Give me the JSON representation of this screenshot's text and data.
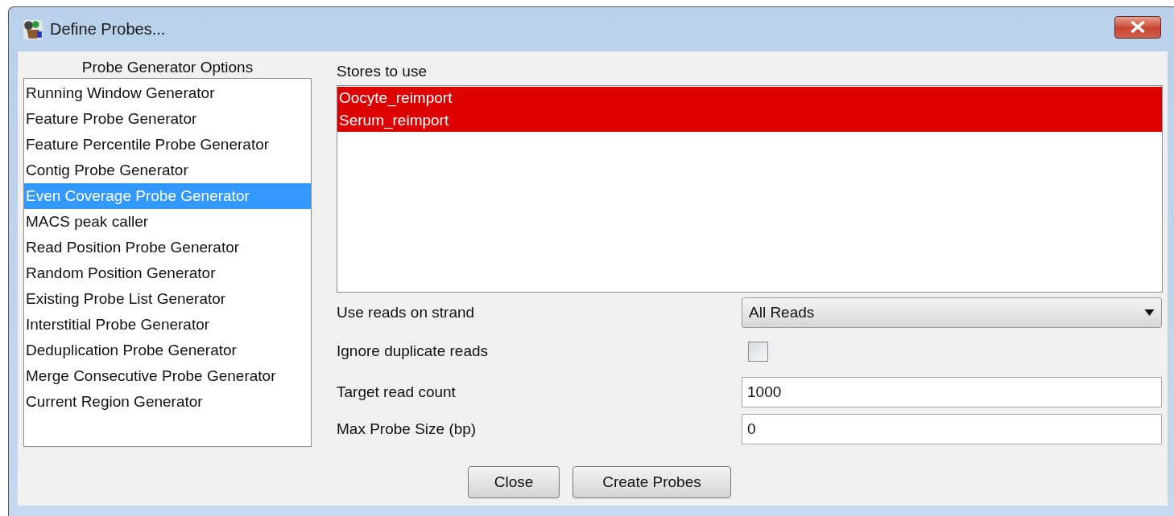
{
  "window": {
    "title": "Define Probes..."
  },
  "generator_options": {
    "heading": "Probe Generator Options",
    "items": [
      {
        "label": "Running Window Generator",
        "selected": false
      },
      {
        "label": "Feature Probe Generator",
        "selected": false
      },
      {
        "label": "Feature Percentile Probe Generator",
        "selected": false
      },
      {
        "label": "Contig Probe Generator",
        "selected": false
      },
      {
        "label": "Even Coverage Probe Generator",
        "selected": true
      },
      {
        "label": "MACS peak caller",
        "selected": false
      },
      {
        "label": "Read Position Probe Generator",
        "selected": false
      },
      {
        "label": "Random Position Generator",
        "selected": false
      },
      {
        "label": "Existing Probe List Generator",
        "selected": false
      },
      {
        "label": "Interstitial Probe Generator",
        "selected": false
      },
      {
        "label": "Deduplication Probe Generator",
        "selected": false
      },
      {
        "label": "Merge Consecutive Probe Generator",
        "selected": false
      },
      {
        "label": "Current Region Generator",
        "selected": false
      }
    ]
  },
  "stores": {
    "heading": "Stores to use",
    "items": [
      {
        "label": "Oocyte_reimport",
        "selected": true
      },
      {
        "label": "Serum_reimport",
        "selected": true
      }
    ]
  },
  "options": [
    {
      "kind": "dropdown",
      "label": "Use reads on strand",
      "value": "All Reads"
    },
    {
      "kind": "checkbox",
      "label": "Ignore duplicate reads",
      "checked": false
    },
    {
      "kind": "text",
      "label": "Target read count",
      "value": "1000"
    },
    {
      "kind": "text",
      "label": "Max Probe Size (bp)",
      "value": "0"
    }
  ],
  "buttons": [
    "Close",
    "Create Probes"
  ]
}
